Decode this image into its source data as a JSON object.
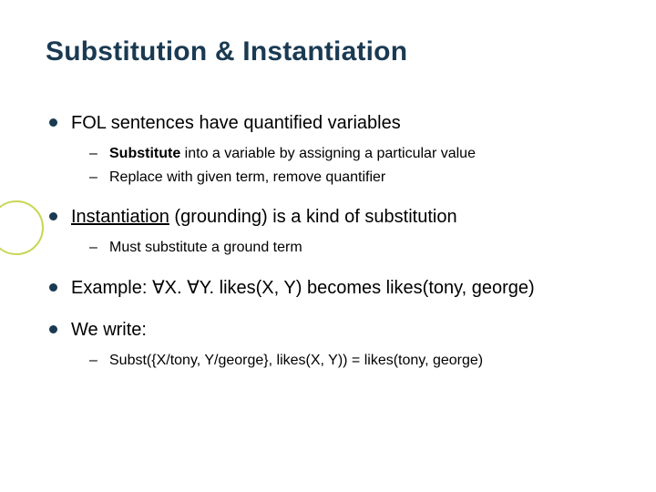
{
  "title": "Substitution & Instantiation",
  "bullets": {
    "b1": {
      "text": "FOL sentences have quantified variables",
      "sub": {
        "s1_pre": "Substitute",
        "s1_post": " into a variable by assigning a particular value",
        "s2": "Replace with given term, remove quantifier"
      }
    },
    "b2": {
      "pre": "Instantiation",
      "post": " (grounding) is a kind of substitution",
      "sub": {
        "s1": "Must substitute a ground term"
      }
    },
    "b3": {
      "pre": "Example: ",
      "sym1": "∀",
      "mid1": "X. ",
      "sym2": "∀",
      "mid2": "Y. likes(X, Y) becomes likes(tony, george)"
    },
    "b4": {
      "text": "We write:",
      "sub": {
        "s1": "Subst({X/tony, Y/george}, likes(X, Y)) = likes(tony, george)"
      }
    }
  }
}
